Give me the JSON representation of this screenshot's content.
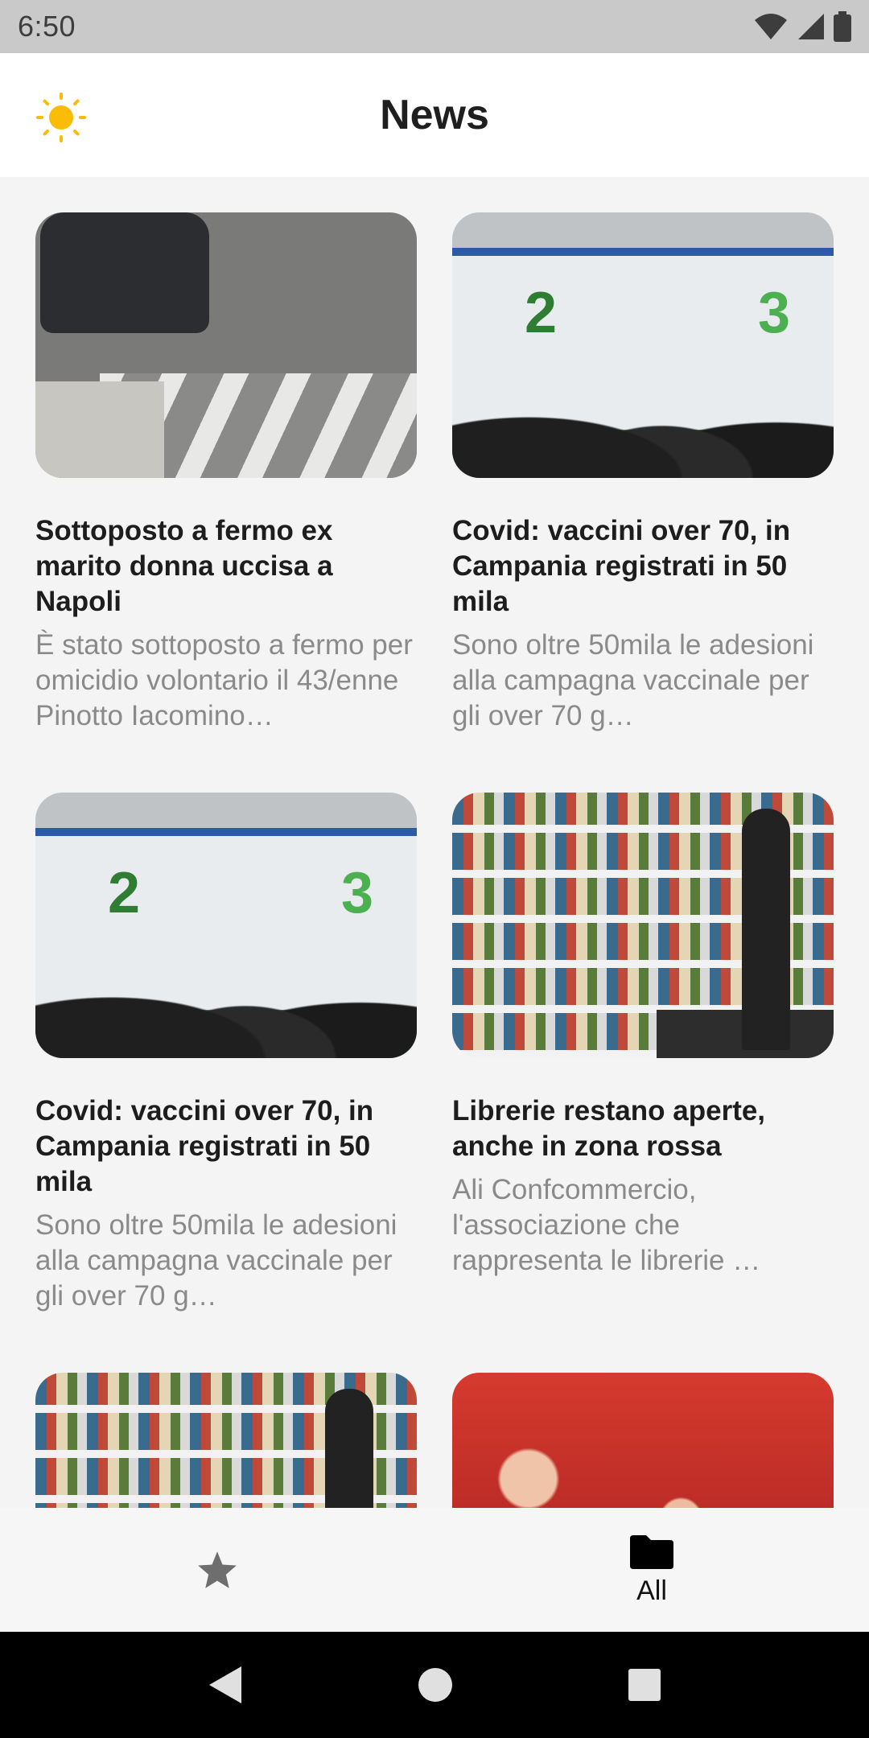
{
  "status_bar": {
    "time": "6:50"
  },
  "app_bar": {
    "title": "News",
    "theme_icon": "sun-icon"
  },
  "articles": [
    {
      "title": "Sottoposto a fermo ex marito donna uccisa a Napoli",
      "description": "È stato sottoposto a fermo per omicidio volontario il 43/enne Pinotto Iacomino…"
    },
    {
      "title": "Covid: vaccini over 70, in Campania registrati in 50 mila",
      "description": "Sono oltre 50mila le adesioni alla campagna vaccinale per gli over 70 g…",
      "image_numbers": [
        "2",
        "3"
      ]
    },
    {
      "title": "Covid: vaccini over 70, in Campania registrati in 50 mila",
      "description": "Sono oltre 50mila le adesioni alla campagna vaccinale per gli over 70 g…",
      "image_numbers": [
        "2",
        "3"
      ]
    },
    {
      "title": "Librerie restano aperte, anche in zona rossa",
      "description": "Ali Confcommercio, l'associazione che rappresenta le librerie …"
    }
  ],
  "bottom_nav": {
    "favorites": {
      "icon": "star-icon"
    },
    "all": {
      "label": "All",
      "icon": "folder-icon"
    }
  },
  "colors": {
    "accent_sun": "#fbbc05",
    "background": "#f4f4f4",
    "title_text": "#1d1d1d",
    "description_text": "#8a8a8a"
  }
}
